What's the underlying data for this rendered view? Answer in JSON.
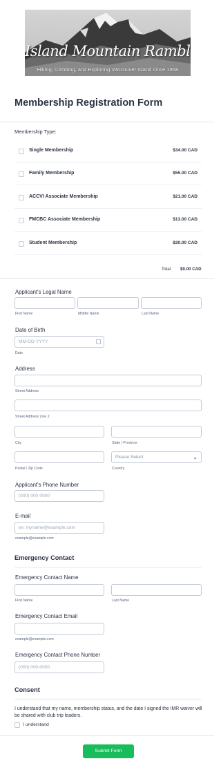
{
  "banner": {
    "title": "Island Mountain Ramblers",
    "subtitle": "Hiking, Climbing, and Exploring Vancouver Island since 1958"
  },
  "form": {
    "title": "Membership Registration Form"
  },
  "membership": {
    "label": "Membership Type:",
    "items": [
      {
        "name": "Single Membership",
        "price": "$34.00 CAD"
      },
      {
        "name": "Family Membership",
        "price": "$55.00 CAD"
      },
      {
        "name": "ACCVI Associate Membership",
        "price": "$21.00 CAD"
      },
      {
        "name": "FMCBC Associate Membership",
        "price": "$13.00 CAD"
      },
      {
        "name": "Student Membership",
        "price": "$20.00 CAD"
      }
    ],
    "total_label": "Total",
    "total_value": "$0.00 CAD"
  },
  "applicant_name": {
    "label": "Applicant's Legal Name",
    "first": "First Name",
    "middle": "Middle Name",
    "last": "Last Name"
  },
  "dob": {
    "label": "Date of Birth",
    "placeholder": "MM-DD-YYYY",
    "sublabel": "Date"
  },
  "address": {
    "label": "Address",
    "street": "Street Address",
    "street2": "Street Address Line 2",
    "city": "City",
    "state": "State / Province",
    "postal": "Postal / Zip Code",
    "country": "Country",
    "country_placeholder": "Please Select"
  },
  "phone": {
    "label": "Applicant's Phone Number",
    "placeholder": "(000) 000-0000"
  },
  "email": {
    "label": "E-mail",
    "placeholder": "ex: myname@example.com",
    "sublabel": "example@example.com"
  },
  "emergency": {
    "heading": "Emergency Contact",
    "name_label": "Emergency Contact Name",
    "first": "First Name",
    "last": "Last Name",
    "email_label": "Emergency Contact Email",
    "email_sublabel": "example@example.com",
    "phone_label": "Emergency Contact Phone Number",
    "phone_placeholder": "(000) 000-0000"
  },
  "consent": {
    "heading": "Consent",
    "text": "I understand that my name, membership status, and the date I signed the IMR waiver will be shared with club trip leaders.",
    "checkbox_label": "I understand"
  },
  "submit": {
    "label": "Submit Form"
  },
  "colors": {
    "submit": "#18bd5b",
    "text": "#2c3345",
    "border": "#c3cad8"
  }
}
